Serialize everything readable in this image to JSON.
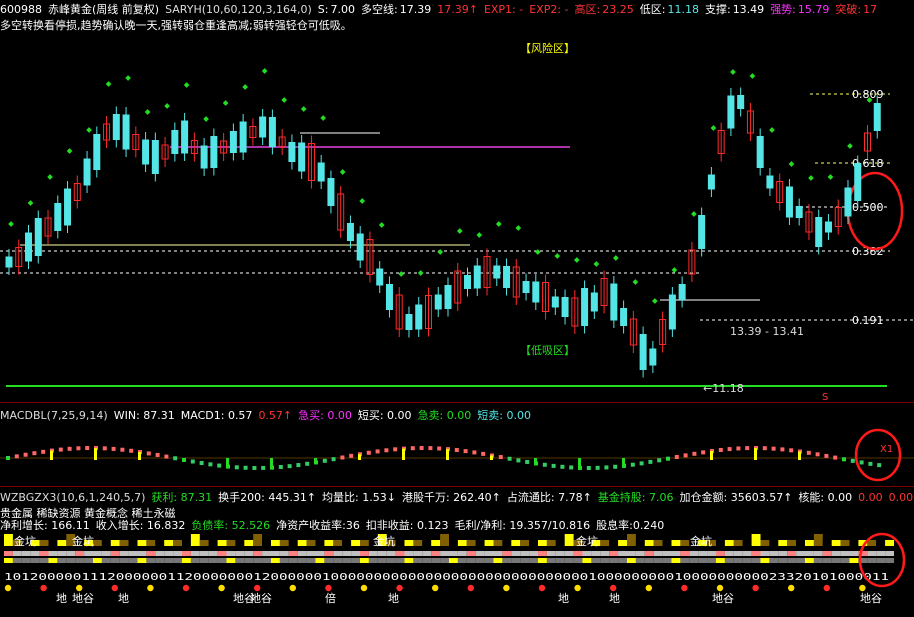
{
  "colors": {
    "bg": "#000000",
    "bull": "#ff2a2a",
    "bear": "#54e6e6",
    "dot": "#22dd22",
    "grid": "#7a0000",
    "yellow": "#ffff00",
    "magenta": "#ff33ff",
    "white": "#ffffff"
  },
  "header": {
    "stock_code": "600988",
    "stock_name": "赤峰黄金(周线 前复权)",
    "indicator": "SARYH(10,60,120,3,164,0)",
    "s_label": "S:",
    "s_value": "7.00",
    "duo_label": "多空线:",
    "duo_value": "17.39",
    "duo_arrow": "17.39↑",
    "exp1": "EXP1: -",
    "exp2": "EXP2: -",
    "high_label": "高区:",
    "high_value": "23.25",
    "low_label": "低区:",
    "low_value": "11.18",
    "support_label": "支撑:",
    "support_value": "13.49",
    "strong_label": "强势:",
    "strong_value": "15.79",
    "break_label": "突破:",
    "break_value": "17"
  },
  "comment": "多空转换看停损,趋势确认晚一天,强转弱仓重逢高减;弱转强轻仓可低吸。",
  "zones": {
    "risk": "【风险区】",
    "buy": "【低吸区】"
  },
  "fib": {
    "l0809": "0.809",
    "l0618": "0.618",
    "l0500": "0.500",
    "l0382": "0.382",
    "l0191": "0.191"
  },
  "annotations": {
    "range": "13.39 - 13.41",
    "low_price": "←11.18",
    "s_mark": "S"
  },
  "macd": {
    "title": "MACDBL(7,25,9,14)",
    "win": "WIN: 87.31",
    "macd1": "MACD1: 0.57",
    "macd1_arrow": "0.57↑",
    "jimai": "急买: 0.00",
    "duanmai": "短买: 0.00",
    "jimaichu": "急卖: 0.00",
    "duanmaichu": "短卖: 0.00",
    "x1": "X1"
  },
  "wzb": {
    "title": "WZBGZX3(10,6,1,240,5,7)",
    "profit": "获利: 87.31",
    "turnover": "换手200: 445.31↑",
    "vol_ratio": "均量比: 1.53↓",
    "hk": "港股千万: 262.40↑",
    "share": "占流通比: 7.78↑",
    "fund": "基金持股: 7.06",
    "add": "加仓金额: 35603.57↑",
    "core": "核能: 0.00",
    "zero1": "0.00",
    "zero2": "0.00"
  },
  "fundamentals": {
    "line1": "贵金属   稀缺资源 黄金概念 稀土永磁",
    "growth": "净利增长: 166.11",
    "income": "收入增长: 16.832",
    "debt": "负债率: 52.526",
    "roe": "净资产收益率:36",
    "deduct": "扣非收益: 0.123",
    "margin": "毛利/净利: 19.357/10.816",
    "dividend": "股息率:0.240"
  },
  "bottom": {
    "jinkeng": "金坑",
    "digits": "1012000001112000000112000000012000000100000000000000000000000000000010000000001000000000023320101000011",
    "di": "地",
    "digu": "地谷",
    "bei": "倍"
  }
}
